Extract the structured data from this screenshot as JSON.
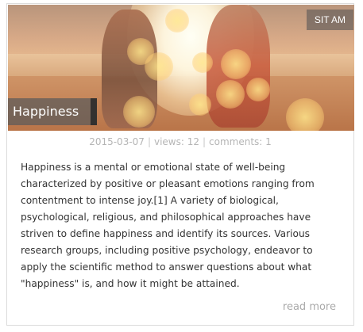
{
  "post": {
    "tag": "SIT AM",
    "title": "Happiness",
    "date": "2015-03-07",
    "views": "views: 12",
    "comments": "comments: 1",
    "separator": "|",
    "body": "Happiness is a mental or emotional state of well-being characterized by positive or pleasant emotions ranging from contentment to intense joy.[1] A variety of biological, psychological, religious, and philosophical approaches have striven to define happiness and identify its sources. Various research groups, including positive psychology, endeavor to apply the scientific method to answer questions about what \"happiness\" is, and how it might be attained.",
    "read_more": "read more"
  },
  "image": {
    "alt_icon": "beach-couple-photo"
  }
}
